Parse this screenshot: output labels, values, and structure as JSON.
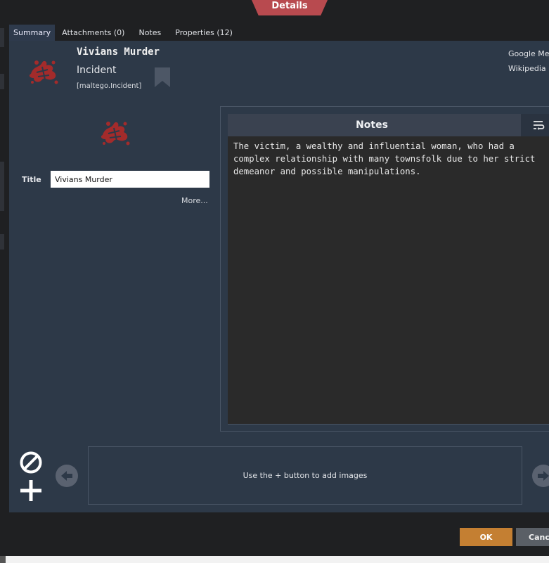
{
  "dialog": {
    "title": "Details"
  },
  "tabs": [
    {
      "label": "Summary",
      "active": true
    },
    {
      "label": "Attachments (0)"
    },
    {
      "label": "Notes"
    },
    {
      "label": "Properties (12)"
    }
  ],
  "entity": {
    "name": "Vivians Murder",
    "type": "Incident",
    "type_id": "[maltego.Incident]",
    "icon": "incident-icon",
    "icon_color": "#a32b2b"
  },
  "links": [
    "Google Mel",
    "Wikipedia M"
  ],
  "fields": {
    "title_label": "Title",
    "title_value": "Vivians Murder",
    "more_label": "More..."
  },
  "notes": {
    "header": "Notes",
    "wrap_icon": "wrap-text-icon",
    "text": "The victim, a wealthy and influential woman, who had a complex relationship with many townsfolk due to her strict demeanor and possible manipulations."
  },
  "images": {
    "hint": "Use the + button to add images",
    "remove_icon": "prohibited-icon",
    "add_icon": "plus-icon",
    "prev_icon": "arrow-left-icon",
    "next_icon": "arrow-right-icon"
  },
  "buttons": {
    "ok": "OK",
    "cancel": "Canc"
  },
  "colors": {
    "accent": "#c47f32",
    "title_tab": "#b84a4f",
    "panel": "#2d3948"
  }
}
